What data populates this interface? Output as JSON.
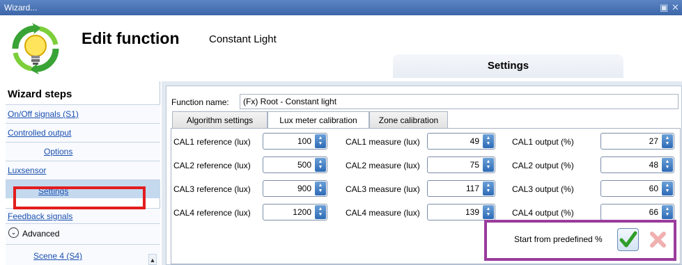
{
  "window": {
    "title": "Wizard..."
  },
  "header": {
    "title": "Edit function",
    "subtitle": "Constant Light",
    "settings_tab": "Settings"
  },
  "sidebar": {
    "title": "Wizard steps",
    "items": [
      {
        "label": "On/Off signals (S1)"
      },
      {
        "label": "Controlled output"
      },
      {
        "label": "Options"
      },
      {
        "label": "Luxsensor"
      },
      {
        "label": "Settings"
      },
      {
        "label": "Feedback signals"
      },
      {
        "label": "Advanced"
      },
      {
        "label": "Scene 4 (S4)"
      }
    ]
  },
  "form": {
    "function_name_label": "Function name:",
    "function_name_value": "(Fx) Root - Constant light",
    "tabs": [
      "Algorithm settings",
      "Lux meter calibration",
      "Zone calibration"
    ],
    "active_tab": "Lux meter calibration",
    "rows": [
      {
        "ref_label": "CAL1 reference (lux)",
        "ref": "100",
        "meas_label": "CAL1 measure (lux)",
        "meas": "49",
        "out_label": "CAL1 output (%)",
        "out": "27"
      },
      {
        "ref_label": "CAL2 reference (lux)",
        "ref": "500",
        "meas_label": "CAL2 measure (lux)",
        "meas": "75",
        "out_label": "CAL2 output (%)",
        "out": "48"
      },
      {
        "ref_label": "CAL3 reference (lux)",
        "ref": "900",
        "meas_label": "CAL3 measure (lux)",
        "meas": "117",
        "out_label": "CAL3 output (%)",
        "out": "60"
      },
      {
        "ref_label": "CAL4 reference (lux)",
        "ref": "1200",
        "meas_label": "CAL4 measure (lux)",
        "meas": "139",
        "out_label": "CAL4 output (%)",
        "out": "66"
      }
    ],
    "predefined_label": "Start from predefined %"
  },
  "colors": {
    "titlebar": "#3c66a8",
    "link": "#1a4fb0",
    "highlight_red": "#e21d1d",
    "highlight_purple": "#9a3c9c",
    "spin_button": "#2d6bb6"
  }
}
